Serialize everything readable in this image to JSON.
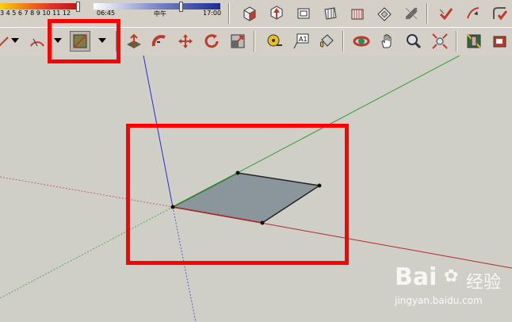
{
  "shadow_bar": {
    "month_ticks": "3 4 5 6 7 8 9 10 11 12",
    "time_partial": "06:45",
    "noon_label": "中午",
    "end_time": "17:00"
  },
  "toolbar": {
    "row1_icons": [
      "iso-view-icon",
      "top-view-icon",
      "front-view-icon",
      "right-view-icon",
      "back-view-icon",
      "left-view-icon",
      "bottom-view-icon",
      "add-location-icon",
      "sandbox-icon",
      "follow-me-icon"
    ],
    "row2_icons": [
      "arc-icon",
      "rectangle-icon",
      "push-pull-icon",
      "follow-me-icon",
      "move-icon",
      "rotate-icon",
      "scale-icon",
      "tape-measure-icon",
      "text-icon",
      "paint-bucket-icon",
      "orbit-icon",
      "pan-icon",
      "zoom-icon",
      "zoom-extents-icon",
      "section-plane-icon",
      "components-icon"
    ],
    "text_tool_label": "A1"
  },
  "watermark": {
    "brand": "Bai",
    "brand2": "经验",
    "url": "jingyan.baidu.com"
  },
  "colors": {
    "highlight": "#ff0000",
    "face": "#8a969b",
    "axis_red": "#c83232",
    "axis_green": "#28a028",
    "axis_blue": "#2d2dcc"
  }
}
